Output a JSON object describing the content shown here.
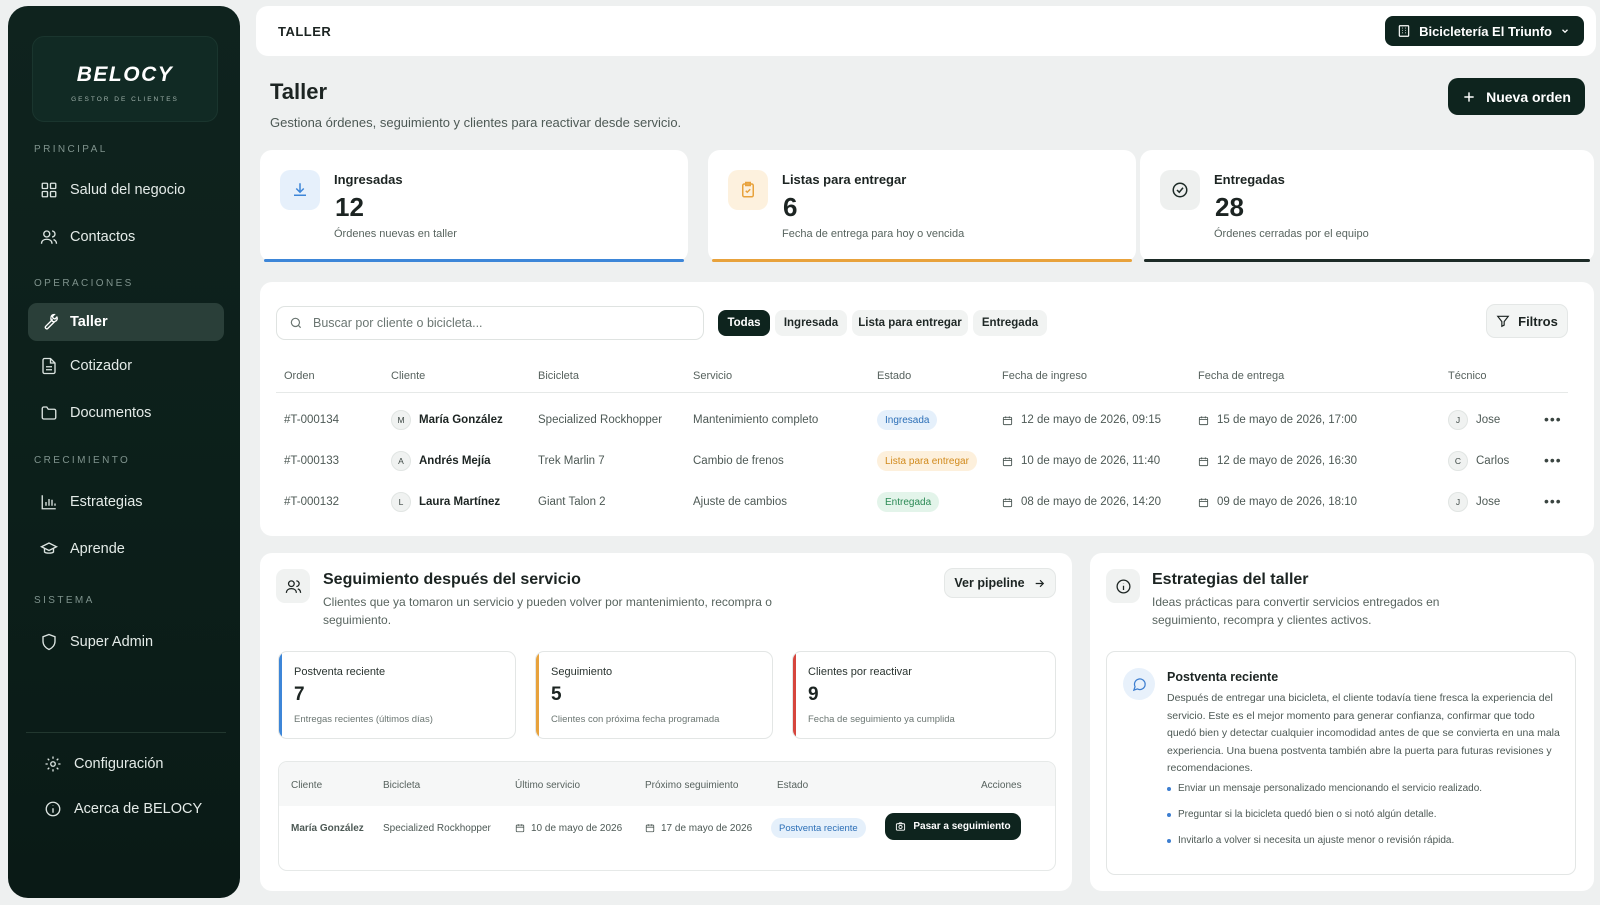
{
  "brand": {
    "name": "BELOCY",
    "tagline": "GESTOR DE CLIENTES"
  },
  "sidebar": {
    "sections": [
      "PRINCIPAL",
      "OPERACIONES",
      "CRECIMIENTO",
      "SISTEMA"
    ],
    "items": [
      {
        "label": "Salud del negocio",
        "icon": "grid-icon"
      },
      {
        "label": "Contactos",
        "icon": "users-icon"
      },
      {
        "label": "Taller",
        "icon": "wrench-icon",
        "active": true
      },
      {
        "label": "Cotizador",
        "icon": "document-icon"
      },
      {
        "label": "Documentos",
        "icon": "folder-icon"
      },
      {
        "label": "Estrategias",
        "icon": "bar-chart-icon"
      },
      {
        "label": "Aprende",
        "icon": "graduation-cap-icon"
      },
      {
        "label": "Super Admin",
        "icon": "shield-icon"
      }
    ],
    "footer": [
      {
        "label": "Configuración",
        "icon": "gear-icon"
      },
      {
        "label": "Acerca de BELOCY",
        "icon": "info-icon"
      }
    ]
  },
  "topbar": {
    "title": "TALLER",
    "store": "Bicicletería El Triunfo"
  },
  "page": {
    "title": "Taller",
    "subtitle": "Gestiona órdenes, seguimiento y clientes para reactivar desde servicio.",
    "new_order": "Nueva orden"
  },
  "stats": [
    {
      "label": "Ingresadas",
      "value": "12",
      "desc": "Órdenes nuevas en taller",
      "color": "#3d86d8"
    },
    {
      "label": "Listas para entregar",
      "value": "6",
      "desc": "Fecha de entrega para hoy o vencida",
      "color": "#e8a23c"
    },
    {
      "label": "Entregadas",
      "value": "28",
      "desc": "Órdenes cerradas por el equipo",
      "color": "#1d2b27"
    }
  ],
  "orders": {
    "search_placeholder": "Buscar por cliente o bicicleta...",
    "chips": [
      "Todas",
      "Ingresada",
      "Lista para entregar",
      "Entregada"
    ],
    "filters_label": "Filtros",
    "headers": [
      "Orden",
      "Cliente",
      "Bicicleta",
      "Servicio",
      "Estado",
      "Fecha de ingreso",
      "Fecha de entrega",
      "Técnico"
    ],
    "rows": [
      {
        "order": "#T-000134",
        "initial": "M",
        "client": "María González",
        "bike": "Specialized Rockhopper",
        "service": "Mantenimiento completo",
        "status": "Ingresada",
        "in": "12 de mayo de 2026, 09:15",
        "out": "15 de mayo de 2026, 17:00",
        "tech_initial": "J",
        "tech": "Jose"
      },
      {
        "order": "#T-000133",
        "initial": "A",
        "client": "Andrés Mejía",
        "bike": "Trek Marlin 7",
        "service": "Cambio de frenos",
        "status": "Lista para entregar",
        "in": "10 de mayo de 2026, 11:40",
        "out": "12 de mayo de 2026, 16:30",
        "tech_initial": "C",
        "tech": "Carlos"
      },
      {
        "order": "#T-000132",
        "initial": "L",
        "client": "Laura Martínez",
        "bike": "Giant Talon 2",
        "service": "Ajuste de cambios",
        "status": "Entregada",
        "in": "08 de mayo de 2026, 14:20",
        "out": "09 de mayo de 2026, 18:10",
        "tech_initial": "J",
        "tech": "Jose"
      }
    ]
  },
  "followup": {
    "title": "Seguimiento después del servicio",
    "subtitle_1": "Clientes que ya tomaron un servicio y pueden volver por mantenimiento, recompra o",
    "subtitle_2": "seguimiento.",
    "pipeline": "Ver pipeline",
    "cards": [
      {
        "label": "Postventa reciente",
        "value": "7",
        "desc": "Entregas recientes (últimos días)",
        "color": "#3d86d8"
      },
      {
        "label": "Seguimiento",
        "value": "5",
        "desc": "Clientes con próxima fecha programada",
        "color": "#e8a23c"
      },
      {
        "label": "Clientes por reactivar",
        "value": "9",
        "desc": "Fecha de seguimiento ya cumplida",
        "color": "#d6453d"
      }
    ],
    "headers": [
      "Cliente",
      "Bicicleta",
      "Último servicio",
      "Próximo seguimiento",
      "Estado",
      "Acciones"
    ],
    "row": {
      "client": "María González",
      "bike": "Specialized Rockhopper",
      "last": "10 de mayo de 2026",
      "next": "17 de mayo de 2026",
      "status": "Postventa reciente",
      "action": "Pasar a seguimiento"
    }
  },
  "strategies": {
    "title": "Estrategias del taller",
    "subtitle_1": "Ideas prácticas para convertir servicios entregados en",
    "subtitle_2": "seguimiento, recompra y clientes activos.",
    "box_title": "Postventa reciente",
    "box_text": "Después de entregar una bicicleta, el cliente todavía tiene fresca la experiencia del servicio. Este es el mejor momento para generar confianza, confirmar que todo quedó bien y detectar cualquier incomodidad antes de que se convierta en una mala experiencia. Una buena postventa también abre la puerta para futuras revisiones y recomendaciones.",
    "bullets": [
      "Enviar un mensaje personalizado mencionando el servicio realizado.",
      "Preguntar si la bicicleta quedó bien o si notó algún detalle.",
      "Invitarlo a volver si necesita un ajuste menor o revisión rápida."
    ]
  }
}
